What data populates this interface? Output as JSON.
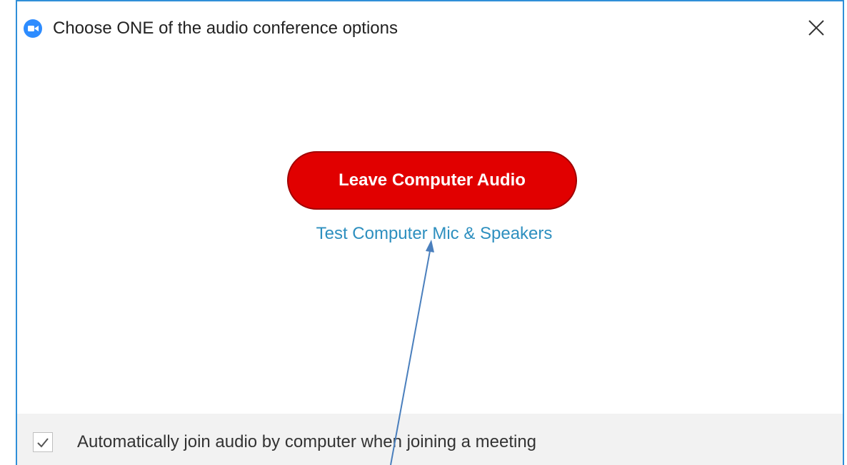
{
  "window": {
    "title": "Choose ONE of the audio conference options",
    "app_icon": "zoom-app-icon",
    "close_icon": "close-icon"
  },
  "main": {
    "leave_button_label": "Leave Computer Audio",
    "test_link_label": "Test Computer Mic & Speakers"
  },
  "footer": {
    "auto_join_label": "Automatically join audio by computer when joining a meeting",
    "auto_join_checked": true
  },
  "colors": {
    "leave_button": "#e10000",
    "link": "#2d8fbf",
    "window_border": "#2f8fd8",
    "annotation_arrow": "#4a7fbd"
  }
}
